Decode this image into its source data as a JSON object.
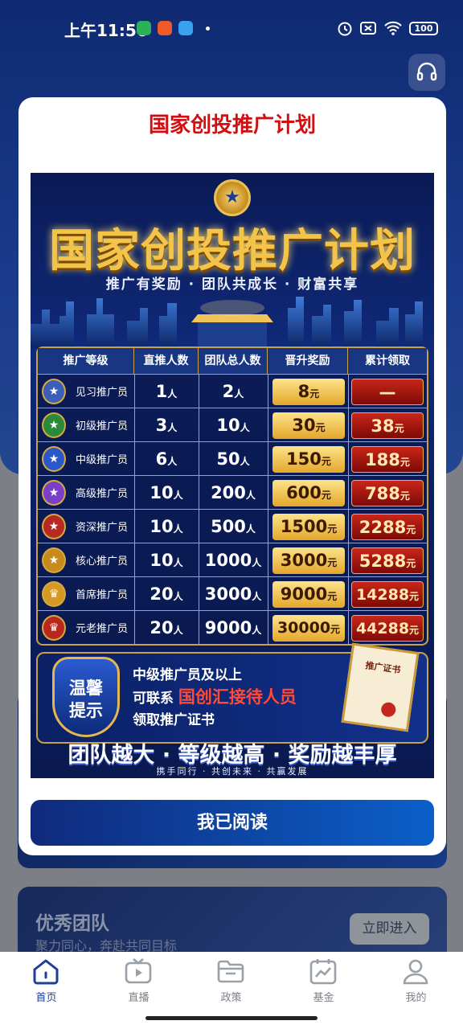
{
  "status_bar": {
    "time": "上午11:56",
    "battery": "100"
  },
  "modal": {
    "title": "国家创投推广计划",
    "poster": {
      "headline": "国家创投推广计划",
      "tagline": "推广有奖励 · 团队共成长 · 财富共享",
      "table_headers": [
        "推广等级",
        "直推人数",
        "团队总人数",
        "晋升奖励",
        "累计领取"
      ],
      "rows": [
        {
          "level": "见习推广员",
          "direct": "1",
          "team": "2",
          "reward": "8",
          "cumulative": "—"
        },
        {
          "level": "初级推广员",
          "direct": "3",
          "team": "10",
          "reward": "30",
          "cumulative": "38"
        },
        {
          "level": "中级推广员",
          "direct": "6",
          "team": "50",
          "reward": "150",
          "cumulative": "188"
        },
        {
          "level": "高级推广员",
          "direct": "10",
          "team": "200",
          "reward": "600",
          "cumulative": "788"
        },
        {
          "level": "资深推广员",
          "direct": "10",
          "team": "500",
          "reward": "1500",
          "cumulative": "2288"
        },
        {
          "level": "核心推广员",
          "direct": "10",
          "team": "1000",
          "reward": "3000",
          "cumulative": "5288"
        },
        {
          "level": "首席推广员",
          "direct": "20",
          "team": "3000",
          "reward": "9000",
          "cumulative": "14288"
        },
        {
          "level": "元老推广员",
          "direct": "20",
          "team": "9000",
          "reward": "30000",
          "cumulative": "44288"
        }
      ],
      "unit_person": "人",
      "unit_yuan": "元",
      "tip_badge_1": "温馨",
      "tip_badge_2": "提示",
      "tip_line1": "中级推广员及以上",
      "tip_line2_prefix": "可联系",
      "tip_line2_highlight": "国创汇接待人员",
      "tip_line3": "领取推广证书",
      "certificate": "推广证书",
      "slogan": "团队越大 · 等级越高 · 奖励越丰厚",
      "slogan_sub": "携手同行 · 共创未来 · 共赢发展"
    },
    "confirm_button": "我已阅读"
  },
  "team_card": {
    "title": "优秀团队",
    "subtitle": "聚力同心，奔赴共同目标",
    "button": "立即进入"
  },
  "tabs": [
    {
      "label": "首页",
      "icon": "home-icon",
      "active": true
    },
    {
      "label": "直播",
      "icon": "live-tv-icon",
      "active": false
    },
    {
      "label": "政策",
      "icon": "folder-icon",
      "active": false
    },
    {
      "label": "基金",
      "icon": "fund-chart-icon",
      "active": false
    },
    {
      "label": "我的",
      "icon": "profile-icon",
      "active": false
    }
  ],
  "colors": {
    "accent": "#1a3b8c",
    "title_red": "#d10f12",
    "gold": "#f4c44a"
  }
}
